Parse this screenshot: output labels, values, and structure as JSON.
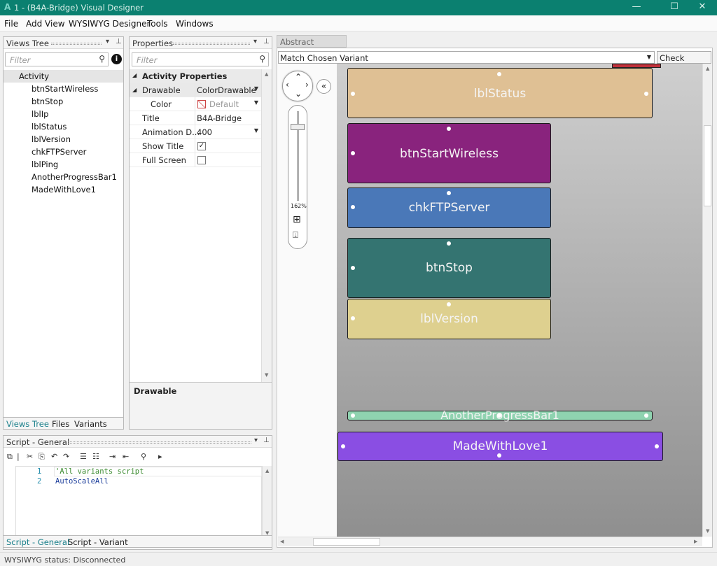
{
  "window": {
    "title": "1 - (B4A-Bridge) Visual Designer",
    "app_icon": "A"
  },
  "menu": [
    "File",
    "Add View",
    "WYSIWYG Designer",
    "Tools",
    "Windows"
  ],
  "views_tree": {
    "header": "Views Tree",
    "filter_placeholder": "Filter",
    "root": "Activity",
    "items": [
      "btnStartWireless",
      "btnStop",
      "lblIp",
      "lblStatus",
      "lblVersion",
      "chkFTPServer",
      "lblPing",
      "AnotherProgressBar1",
      "MadeWithLove1"
    ],
    "tabs": [
      "Views Tree",
      "Files",
      "Variants"
    ]
  },
  "properties": {
    "header": "Properties",
    "filter_placeholder": "Filter",
    "section": "Activity Properties",
    "rows": [
      {
        "name": "Drawable",
        "value": "ColorDrawable"
      },
      {
        "name": "Color",
        "value": "Default"
      },
      {
        "name": "Title",
        "value": "B4A-Bridge"
      },
      {
        "name": "Animation D...",
        "value": "400"
      },
      {
        "name": "Show Title",
        "value": "✓"
      },
      {
        "name": "Full Screen",
        "value": ""
      }
    ],
    "description_title": "Drawable"
  },
  "script": {
    "header": "Script - General",
    "lines": [
      {
        "num": "1",
        "text": "'All variants script"
      },
      {
        "num": "2",
        "text": "AutoScaleAll"
      }
    ],
    "tabs": [
      "Script - General",
      "Script - Variant"
    ]
  },
  "designer": {
    "tab": "Abstract Designer",
    "variant_select": "Match Chosen Variant",
    "check_anchors": "Check Anchors",
    "zoom": "162%",
    "views": [
      {
        "label": "lblStatus",
        "color": "#dfc094"
      },
      {
        "label": "btnStartWireless",
        "color": "#89237d"
      },
      {
        "label": "chkFTPServer",
        "color": "#4a78b8"
      },
      {
        "label": "btnStop",
        "color": "#347471"
      },
      {
        "label": "lblVersion",
        "color": "#ded08f"
      },
      {
        "label": "AnotherProgressBar1",
        "color": "#8fd3b0"
      },
      {
        "label": "MadeWithLove1",
        "color": "#8a4ee3"
      }
    ]
  },
  "status": {
    "text": "WYSIWYG status: Disconnected"
  },
  "colors": {
    "titlebar": "#0b8070",
    "accent_tab": "#1a7f8a"
  }
}
